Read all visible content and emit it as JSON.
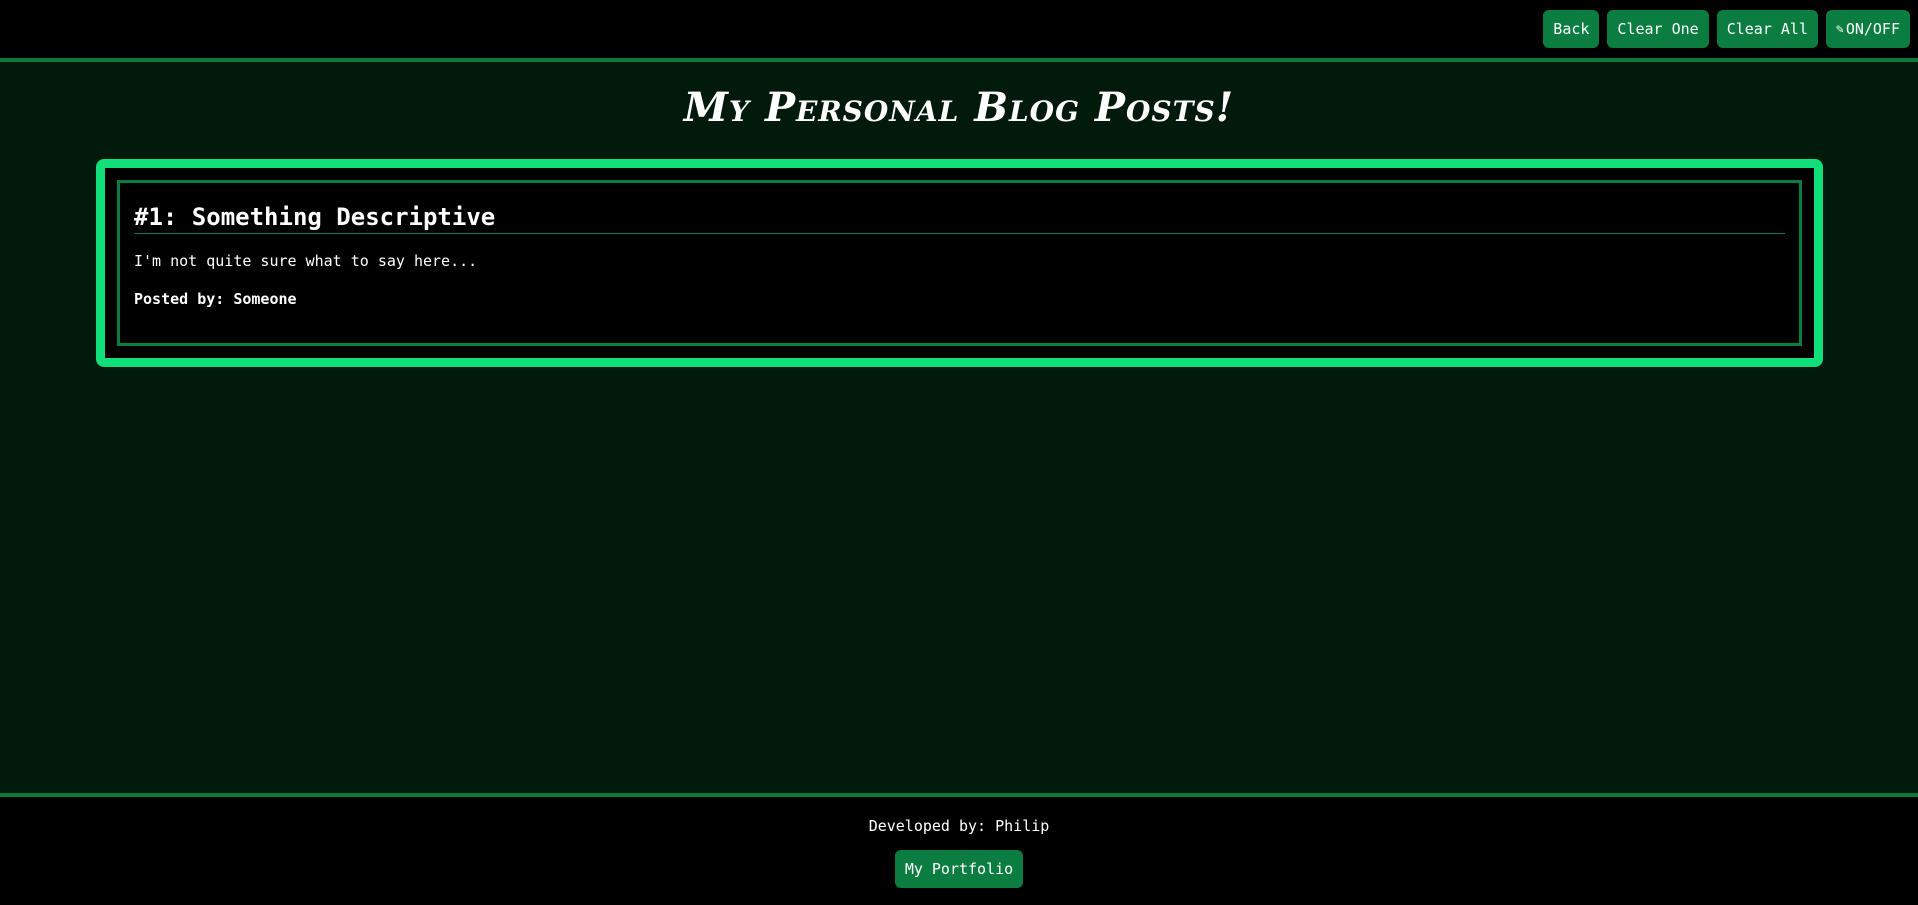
{
  "header": {
    "buttons": {
      "back": "Back",
      "clear_one": "Clear One",
      "clear_all": "Clear All",
      "toggle_icon": "✎",
      "toggle": "ON/OFF"
    }
  },
  "page": {
    "title": "My Personal Blog Posts!"
  },
  "posts": [
    {
      "title": "#1: Something Descriptive",
      "body": "I'm not quite sure what to say here...",
      "author": "Posted by: Someone"
    }
  ],
  "footer": {
    "credit": "Developed by: Philip",
    "portfolio_label": "My Portfolio"
  },
  "colors": {
    "background": "#021a0c",
    "bar": "#000000",
    "accent": "#11df7a",
    "button": "#0b7d40"
  }
}
